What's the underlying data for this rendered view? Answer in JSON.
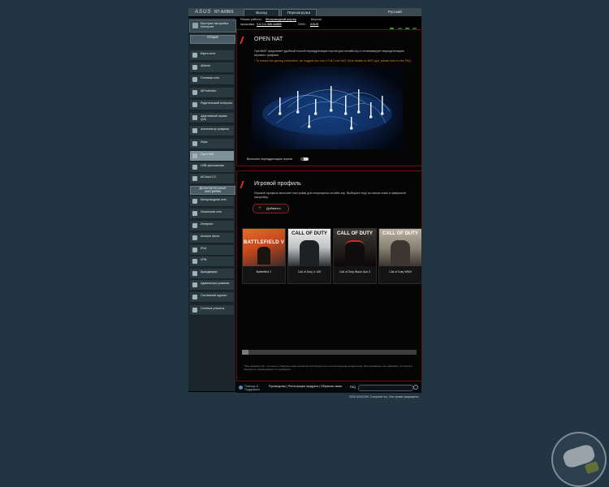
{
  "header": {
    "logo": "ASUS",
    "model": "RT-AX86S",
    "logout_label": "Выход",
    "reboot_label": "Перезагрузка",
    "language": "Русский"
  },
  "info": {
    "mode_label": "Режим работы:",
    "mode_value": "беспроводной роутер",
    "version_label": "Версия",
    "firmware_label": "прошивки:",
    "firmware_value": "3.0.0.4.386.44888",
    "ssid_label": "SSID:",
    "ssid_value": "ASUS"
  },
  "sidebar": {
    "quick_setup": "Быстрая настройка Интернет",
    "general_header": "Общие",
    "general_items": [
      "Карта сети",
      "AiMesh",
      "Гостевая сеть",
      "AiProtection",
      "Родительский контроль",
      "Адаптивный сервис QoS",
      "Анализатор трафика",
      "Игры",
      "Open NAT",
      "USB-приложение",
      "AiCloud 2.0"
    ],
    "advanced_header": "Дополнительные настройки",
    "advanced_items": [
      "Беспроводная сеть",
      "Локальная сеть",
      "Интернет",
      "Amazon Alexa",
      "IPv6",
      "VPN",
      "Брандмауэр",
      "Администри-рование",
      "Системный журнал",
      "Сетевые утилиты"
    ]
  },
  "opennat": {
    "title": "OPEN NAT",
    "description": "OpenNAT предлагает удобный способ переадресации портов для онлайн-игр и оптимизирует маршрутизацию игрового трафика.",
    "tip": "* To ensure the gaming connection, we suggest you use a Full Cone NAT. More details on NAT type, please refer to this FAQ.",
    "toggle_label": "Включить переадресацию портов"
  },
  "profile": {
    "title": "Игровой профиль",
    "description": "Игровой профиль включает настройки для популярных онлайн-игр. Выберите игру из списка ниже и завершите настройку.",
    "add_label": "Добавить",
    "games": [
      {
        "name": "Battlefield V",
        "cover": "BATTLEFIELD V"
      },
      {
        "name": "Call of Duty 4: AW",
        "cover": "CALL OF DUTY"
      },
      {
        "name": "Call of Duty Black Ops 3",
        "cover": "CALL OF DUTY"
      },
      {
        "name": "Call of Duty WWII",
        "cover": "CALL OF DUTY"
      }
    ],
    "note": "* Все названия игр, логотипы и товарные знаки являются собственностью соответствующих владельцев. Использование этих названий, логотипов и брендов не подразумевает их одобрения."
  },
  "footer": {
    "help_label": "Помощь & Поддержка",
    "links": "Руководство | Регистрация продукта | Обратная связь",
    "faq_label": "FAQ"
  },
  "copyright": "2020 ASUSTeK Computer Inc. Все права защищены.",
  "colors": {
    "accent": "#d03a20",
    "panel_border": "#6a1014",
    "sidebar": "#1a262c",
    "active_item": "#7f9099"
  }
}
